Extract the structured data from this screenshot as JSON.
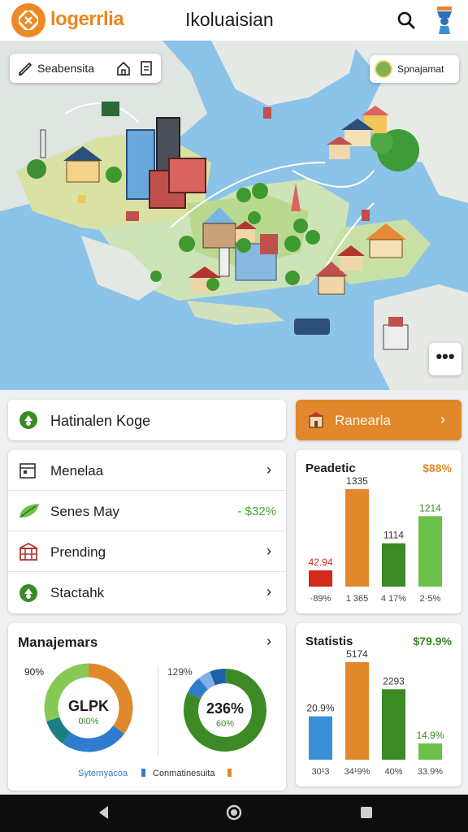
{
  "app": {
    "logo_text": "logerrlia",
    "title": "Ikoluaisian"
  },
  "icons": {
    "logo": "logo-icon",
    "search": "search-icon",
    "user": "user-icon",
    "pen": "pen-icon",
    "home": "home-icon",
    "doc": "document-icon",
    "more": "more-icon",
    "leaf": "leaf-icon",
    "grid": "grid-icon",
    "recycle": "recycle-icon",
    "store": "store-icon"
  },
  "map": {
    "search_label": "Seabensita",
    "chip_label": "Spnajamat",
    "more_label": "•••"
  },
  "hero": {
    "label": "Hatinalen Koge"
  },
  "action_button": {
    "label": "Ranearla"
  },
  "list": {
    "items": [
      {
        "label": "Menelaa",
        "value": null
      },
      {
        "label": "Senes May",
        "value": "- $32%"
      },
      {
        "label": "Prending",
        "value": null
      },
      {
        "label": "Stactahk",
        "value": null
      }
    ]
  },
  "colors": {
    "orange": "#e2882c",
    "green_dark": "#3b8a25",
    "green_light": "#6cc14a",
    "red": "#d42a1a",
    "blue": "#3a8fd9",
    "teal": "#1a7f84"
  },
  "predictic_card": {
    "title": "Peadetic",
    "total": "$88%",
    "chart_data": {
      "type": "bar",
      "categories": [
        "·89%",
        "1 365",
        "4 17%",
        "2·5%"
      ],
      "values": [
        42.94,
        1335,
        1114,
        1214
      ],
      "value_labels": [
        "42.94",
        "1335",
        "1114",
        "1214"
      ],
      "colors": [
        "#d42a1a",
        "#e2882c",
        "#3b8a25",
        "#6cc14a"
      ]
    }
  },
  "statistis_card": {
    "title": "Statistis",
    "total": "$79.9%",
    "chart_data": {
      "type": "bar",
      "categories": [
        "30¹3",
        "34¹9%",
        "40%",
        "33.9%"
      ],
      "values": [
        20.9,
        51.74,
        22.93,
        14.9
      ],
      "value_labels": [
        "20.9%",
        "5174",
        "2293",
        "14.9%"
      ],
      "colors": [
        "#3a8fd9",
        "#e2882c",
        "#3b8a25",
        "#6cc14a"
      ]
    }
  },
  "management": {
    "title": "Manajemars",
    "donut1": {
      "corner_label": "90%",
      "center_title": "GLPK",
      "center_sub": "0I0%",
      "segments": [
        {
          "value": 35,
          "color": "#e2882c"
        },
        {
          "value": 25,
          "color": "#2f7ccf"
        },
        {
          "value": 10,
          "color": "#1a7f84"
        },
        {
          "value": 30,
          "color": "#86c955"
        }
      ]
    },
    "donut2": {
      "corner_label": "129%",
      "center_title": "236%",
      "center_sub": "60%",
      "segments": [
        {
          "value": 82,
          "color": "#3b8a25"
        },
        {
          "value": 7,
          "color": "#2f7ccf"
        },
        {
          "value": 5,
          "color": "#7fb2e6"
        },
        {
          "value": 6,
          "color": "#1f5fa8"
        }
      ]
    },
    "legend": [
      {
        "label": "Syternyacoa",
        "color": "#2f7ccf"
      },
      {
        "label": "Conmatinesuita",
        "color": "#e2882c"
      }
    ]
  }
}
